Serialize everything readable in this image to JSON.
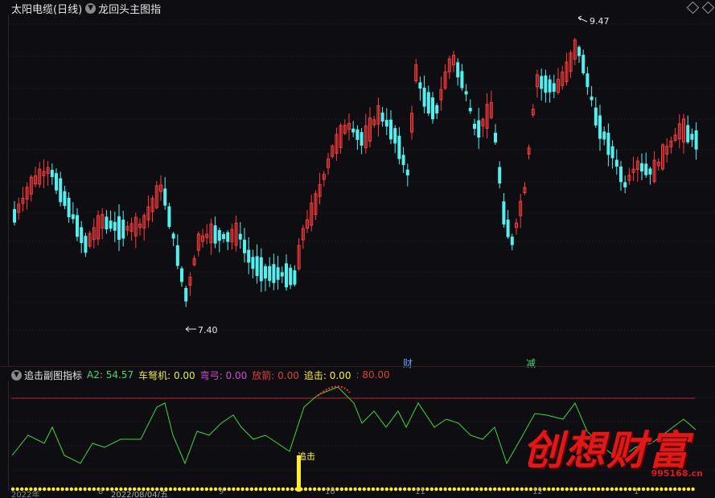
{
  "main": {
    "stock_name": "太阳电缆(日线)",
    "indicator_name": "龙回头主图指",
    "high_label": "9.47",
    "low_label": "7.40",
    "event_markers": [
      {
        "label": "财",
        "color": "#5aa0ff"
      },
      {
        "label": "减",
        "color": "#43d96c"
      }
    ]
  },
  "sub": {
    "indicator_name": "追击副图指标",
    "legend": [
      {
        "name": "A2",
        "value": "54.57",
        "color": "#43d96c"
      },
      {
        "name": "车弩机",
        "value": "0.00",
        "color": "#e6e64a"
      },
      {
        "name": "弯弓",
        "value": "0.00",
        "color": "#d24bd2"
      },
      {
        "name": "放箭",
        "value": "0.00",
        "color": "#e03c3c"
      },
      {
        "name": "追击",
        "value": "0.00",
        "color": "#ffee33"
      }
    ],
    "threshold_label": "80.00",
    "signal_label": "追击"
  },
  "dates": [
    "2022年",
    "8",
    "2022/08/04/五",
    "9",
    "10",
    "11",
    "12",
    "1"
  ],
  "watermark": {
    "text": "创想财富",
    "url": "995168.cn"
  },
  "colors": {
    "up": "#ff3b3b",
    "down": "#54f0f0",
    "threshold": "#c81e1e",
    "line": "#3ad83a",
    "signal": "#ffee22"
  }
}
